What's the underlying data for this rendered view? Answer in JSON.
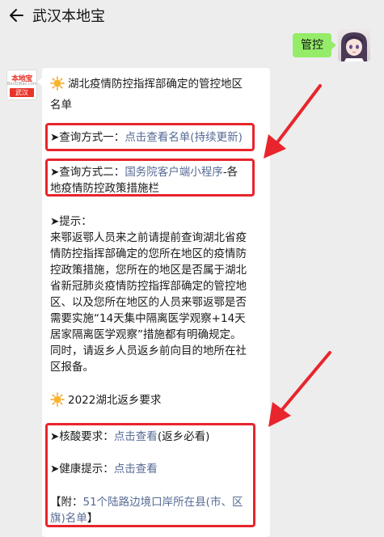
{
  "header": {
    "title": "武汉本地宝",
    "back_icon": "arrow-left-icon"
  },
  "user_message": {
    "text": "管控"
  },
  "bot_avatar": {
    "logo_top": "本地宝",
    "logo_mid": "BenDiBao.com",
    "logo_bottom": "武汉"
  },
  "message": {
    "title_line1": "湖北疫情防控指挥部确定的管控地区",
    "title_line2": "名单",
    "q1_prefix": "➤查询方式一：",
    "q1_link": "点击查看名单(持续更新)",
    "q2_prefix": "➤查询方式二：",
    "q2_link": "国务院客户端小程序",
    "q2_suffix": "-各",
    "q2_line2": "地疫情防控政策措施栏",
    "tip_header": "➤提示：",
    "tip_lines": [
      "来鄂返鄂人员来之前请提前查询湖北省疫",
      "情防控指挥部确定的您所在地区的疫情防",
      "控政策措施，您所在的地区是否属于湖北",
      "省新冠肺炎疫情防控指挥部确定的管控地",
      "区、以及您所在地区的人员来鄂返鄂是否",
      "需要实施“14天集中隔离医学观察+14天",
      "居家隔离医学观察”措施都有明确规定。",
      "同时，请返乡人员返乡前向目的地所在社",
      "区报备。"
    ],
    "section2_title": "2022湖北返乡要求",
    "nucleic_prefix": "➤核酸要求：",
    "nucleic_link": "点击查看",
    "nucleic_suffix": "(返乡必看)",
    "health_prefix": "➤健康提示：",
    "health_link": "点击查看",
    "appendix_prefix": "【附：",
    "appendix_link_line1": "51个陆路边境口岸所在县(市、区",
    "appendix_link_line2": "旗)名单",
    "appendix_suffix": "】"
  },
  "colors": {
    "background": "#ededed",
    "bubble_user": "#95ec69",
    "bubble_bot": "#ffffff",
    "link": "#576b95",
    "annotation_red": "#e8252c"
  }
}
